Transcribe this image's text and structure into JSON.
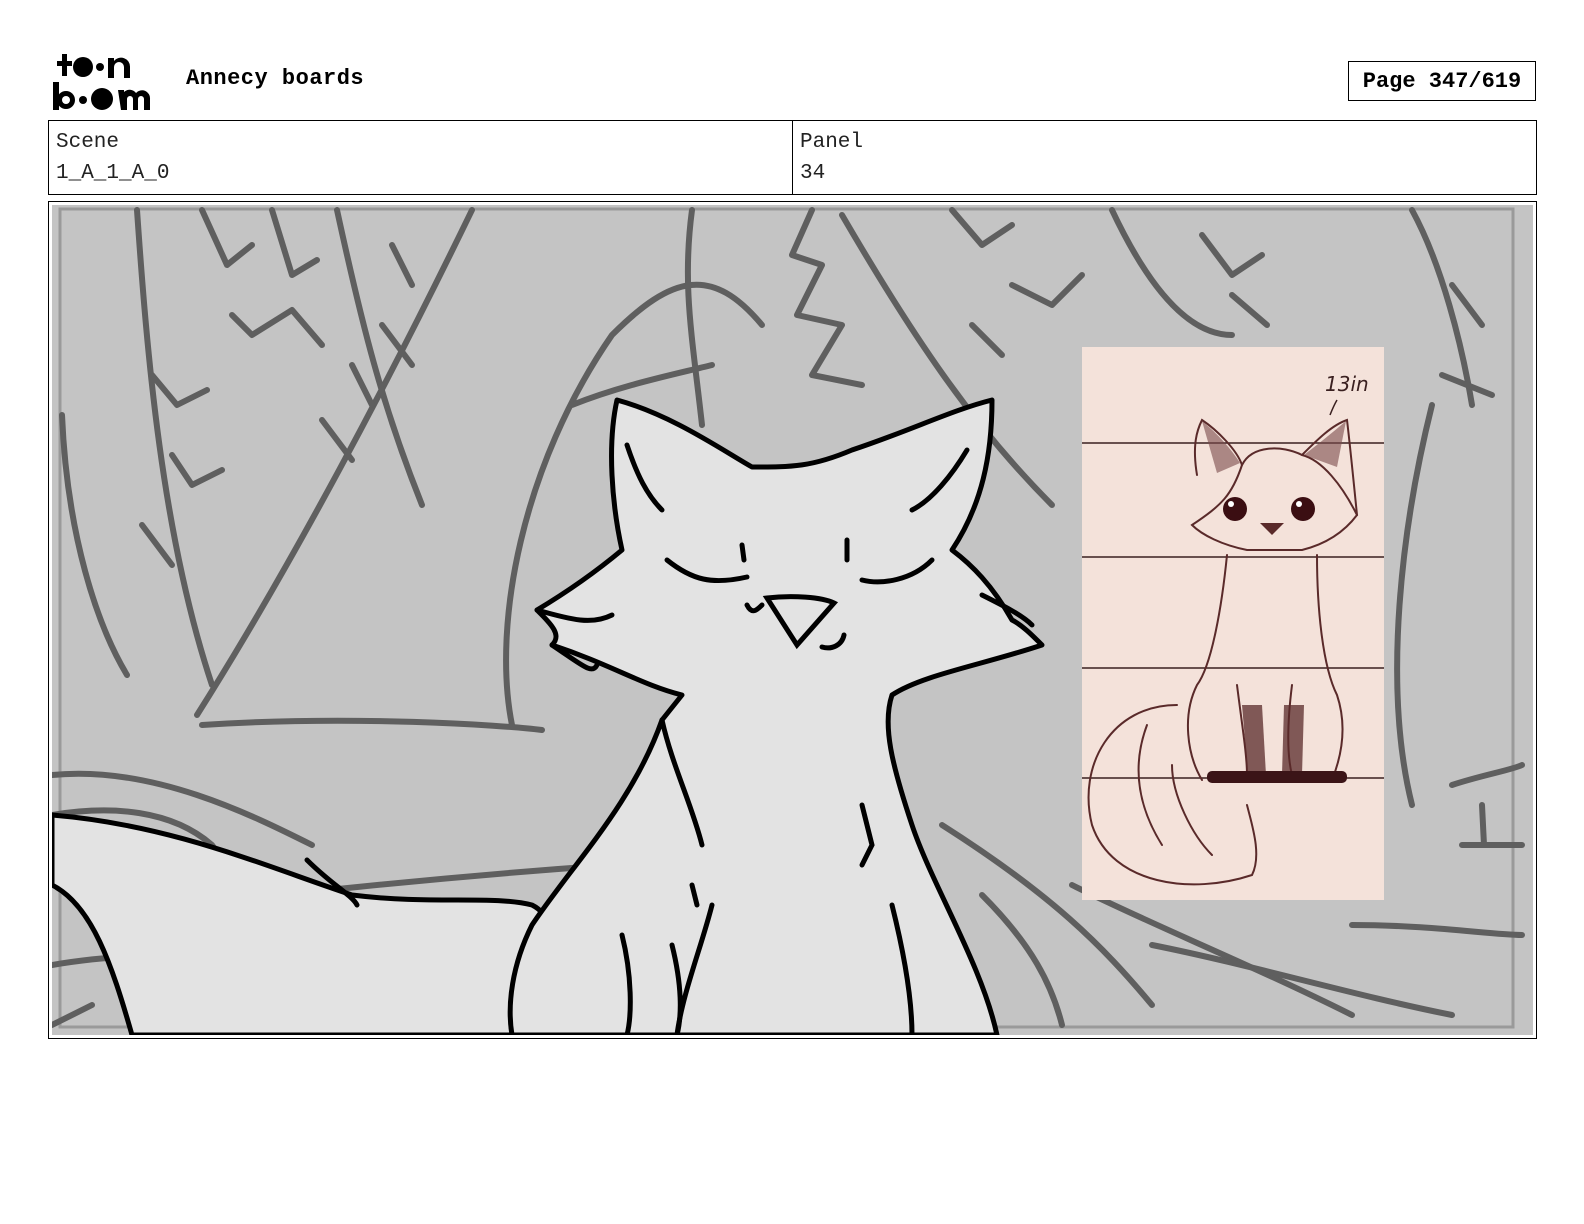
{
  "header": {
    "logo_text": "toon boom",
    "project_title": "Annecy boards",
    "page_indicator": "Page 347/619"
  },
  "info": {
    "scene_label": "Scene",
    "scene_value": "1_A_1_A_0",
    "panel_label": "Panel",
    "panel_value": "34"
  },
  "panel": {
    "reference_note": "13in",
    "colors": {
      "background": "#c4c4c4",
      "sketch_line": "#5f5f5f",
      "fox_fill": "#e3e3e3",
      "reference_bg": "#f4e2da",
      "reference_line": "#5a2a2a"
    }
  }
}
